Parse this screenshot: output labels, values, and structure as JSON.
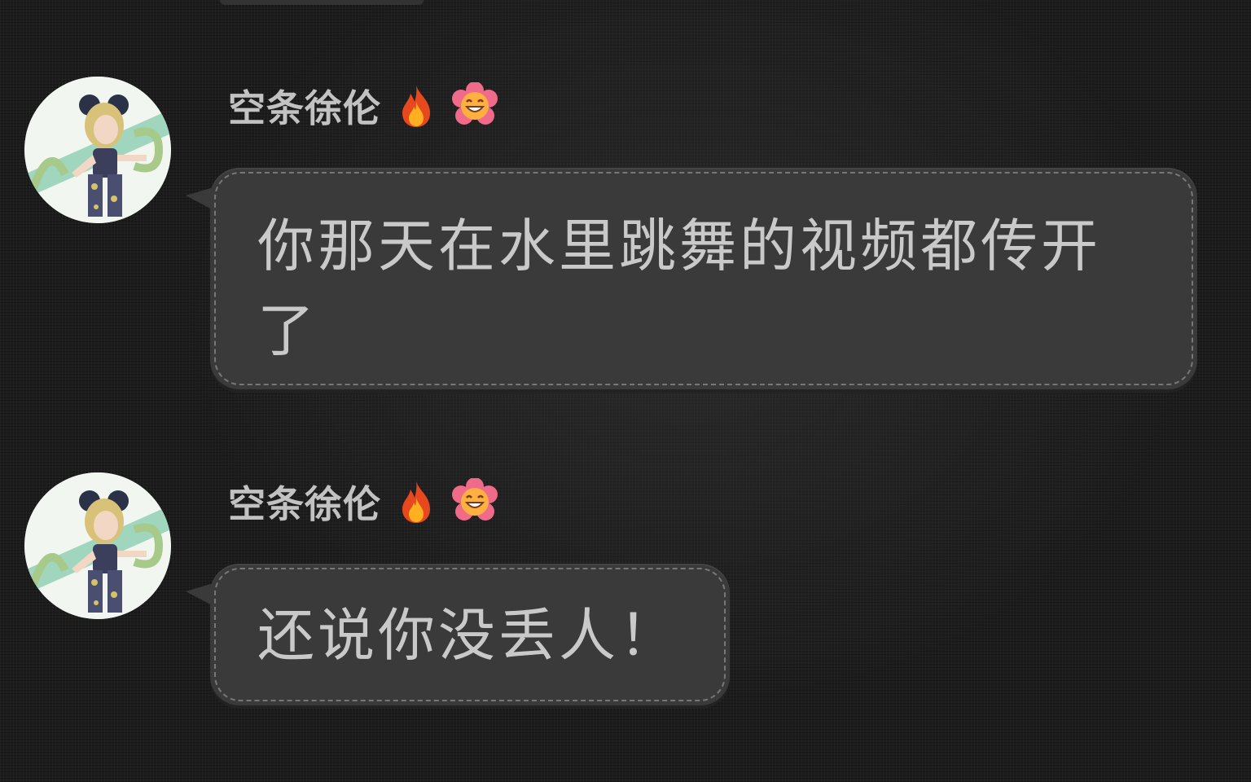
{
  "messages": [
    {
      "sender": "空条徐伦",
      "badges": [
        "fire-icon",
        "smiling-flower-icon"
      ],
      "text": "你那天在水里跳舞的视频都传开了"
    },
    {
      "sender": "空条徐伦",
      "badges": [
        "fire-icon",
        "smiling-flower-icon"
      ],
      "text": "还说你没丢人！"
    }
  ],
  "colors": {
    "background": "#1c1c1c",
    "bubble": "#3a3a3a",
    "text": "#c9c9c9",
    "sender_name": "#c2c2c2",
    "avatar_accent": "#8fcfb4"
  }
}
